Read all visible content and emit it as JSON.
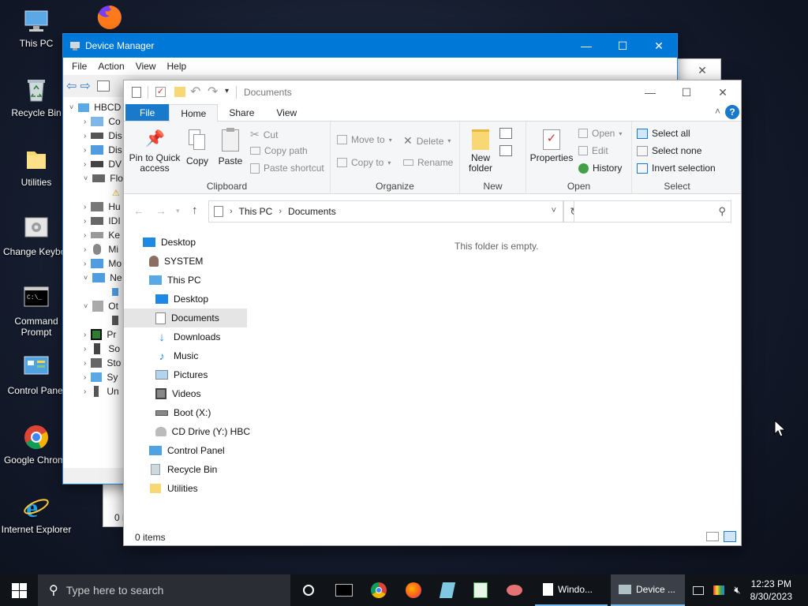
{
  "desktop": {
    "icons": [
      {
        "label": "This PC"
      },
      {
        "label": "Recycle Bin"
      },
      {
        "label": "Utilities"
      },
      {
        "label": "Change Keyboard Layo"
      },
      {
        "label": "Command Prompt"
      },
      {
        "label": "Control Panel"
      },
      {
        "label": "Google Chrom"
      },
      {
        "label": "Internet Explorer"
      }
    ]
  },
  "device_manager": {
    "title": "Device Manager",
    "menu": [
      "File",
      "Action",
      "View",
      "Help"
    ],
    "tree": [
      {
        "label": "HBCD"
      },
      {
        "label": "Co"
      },
      {
        "label": "Dis"
      },
      {
        "label": "Dis"
      },
      {
        "label": "DV"
      },
      {
        "label": "Flo"
      },
      {
        "label": ""
      },
      {
        "label": "Hu"
      },
      {
        "label": "IDI"
      },
      {
        "label": "Ke"
      },
      {
        "label": "Mi"
      },
      {
        "label": "Mo"
      },
      {
        "label": "Ne"
      },
      {
        "label": ""
      },
      {
        "label": "Ot"
      },
      {
        "label": ""
      },
      {
        "label": "Pr"
      },
      {
        "label": "So"
      },
      {
        "label": "Sto"
      },
      {
        "label": "Sy"
      },
      {
        "label": "Un"
      }
    ],
    "bg_status": "0 i"
  },
  "explorer": {
    "title": "Documents",
    "tabs": {
      "file": "File",
      "home": "Home",
      "share": "Share",
      "view": "View"
    },
    "ribbon": {
      "clipboard": {
        "label": "Clipboard",
        "pin": "Pin to Quick access",
        "copy": "Copy",
        "paste": "Paste",
        "cut": "Cut",
        "copy_path": "Copy path",
        "paste_shortcut": "Paste shortcut"
      },
      "organize": {
        "label": "Organize",
        "move_to": "Move to",
        "copy_to": "Copy to",
        "delete": "Delete",
        "rename": "Rename"
      },
      "new": {
        "label": "New",
        "new_folder": "New folder"
      },
      "open": {
        "label": "Open",
        "properties": "Properties",
        "open": "Open",
        "edit": "Edit",
        "history": "History"
      },
      "select": {
        "label": "Select",
        "select_all": "Select all",
        "select_none": "Select none",
        "invert": "Invert selection"
      }
    },
    "address": {
      "crumbs": [
        "This PC",
        "Documents"
      ]
    },
    "search": {
      "placeholder": ""
    },
    "nav": [
      {
        "label": "Desktop"
      },
      {
        "label": "SYSTEM"
      },
      {
        "label": "This PC"
      },
      {
        "label": "Desktop"
      },
      {
        "label": "Documents"
      },
      {
        "label": "Downloads"
      },
      {
        "label": "Music"
      },
      {
        "label": "Pictures"
      },
      {
        "label": "Videos"
      },
      {
        "label": "Boot (X:)"
      },
      {
        "label": "CD Drive (Y:) HBC"
      },
      {
        "label": "Control Panel"
      },
      {
        "label": "Recycle Bin"
      },
      {
        "label": "Utilities"
      }
    ],
    "empty_message": "This folder is empty.",
    "status": "0 items"
  },
  "taskbar": {
    "search_placeholder": "Type here to search",
    "windows": [
      {
        "label": "Windo..."
      },
      {
        "label": "Device ..."
      }
    ],
    "clock": {
      "time": "12:23 PM",
      "date": "8/30/2023"
    }
  },
  "colors": {
    "accent": "#0078d7",
    "file_tab": "#1979ca",
    "taskbar": "#101419"
  }
}
